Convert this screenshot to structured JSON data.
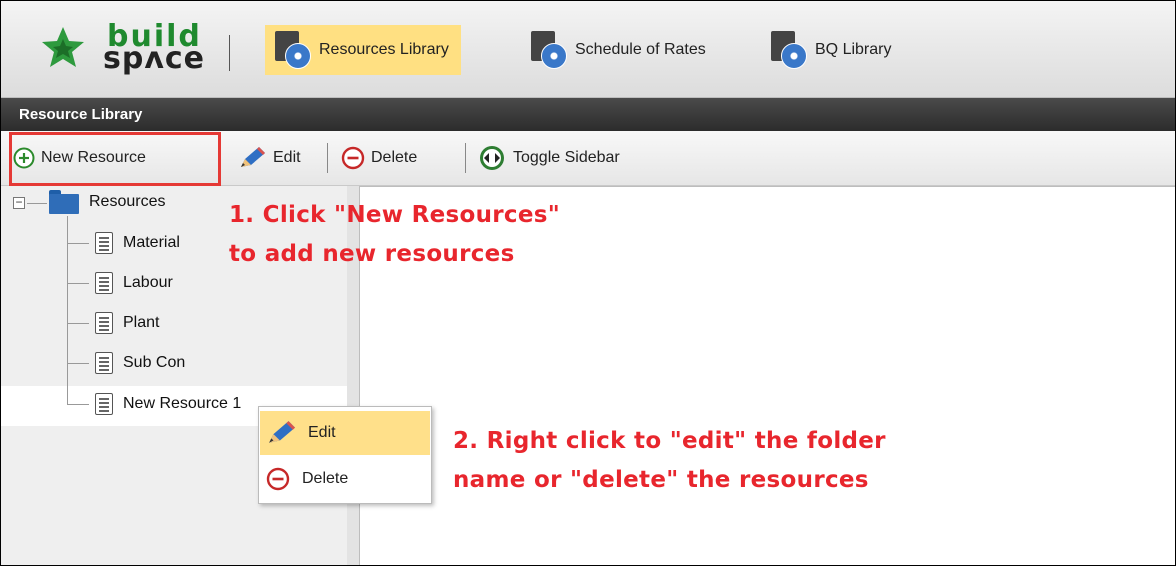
{
  "header": {
    "logo_top": "build",
    "logo_bottom": "spʌce",
    "nav": [
      {
        "label": "Resources Library",
        "active": true
      },
      {
        "label": "Schedule of Rates",
        "active": false
      },
      {
        "label": "BQ Library",
        "active": false
      }
    ]
  },
  "panel": {
    "title": "Resource Library"
  },
  "toolbar": {
    "new_resource": "New Resource",
    "edit": "Edit",
    "delete": "Delete",
    "toggle_sidebar": "Toggle Sidebar"
  },
  "tree": {
    "root": "Resources",
    "items": [
      "Material",
      "Labour",
      "Plant",
      "Sub Con",
      "New Resource 1"
    ]
  },
  "context_menu": {
    "edit": "Edit",
    "delete": "Delete"
  },
  "annotations": {
    "step1_line1": "1. Click \"New Resources\"",
    "step1_line2": "to add new resources",
    "step2_line1": "2. Right click to \"edit\" the folder",
    "step2_line2": "name or \"delete\" the resources"
  },
  "colors": {
    "accent_active": "#ffe082",
    "annotation_red": "#e8262d",
    "logo_green": "#1f8a2e"
  }
}
